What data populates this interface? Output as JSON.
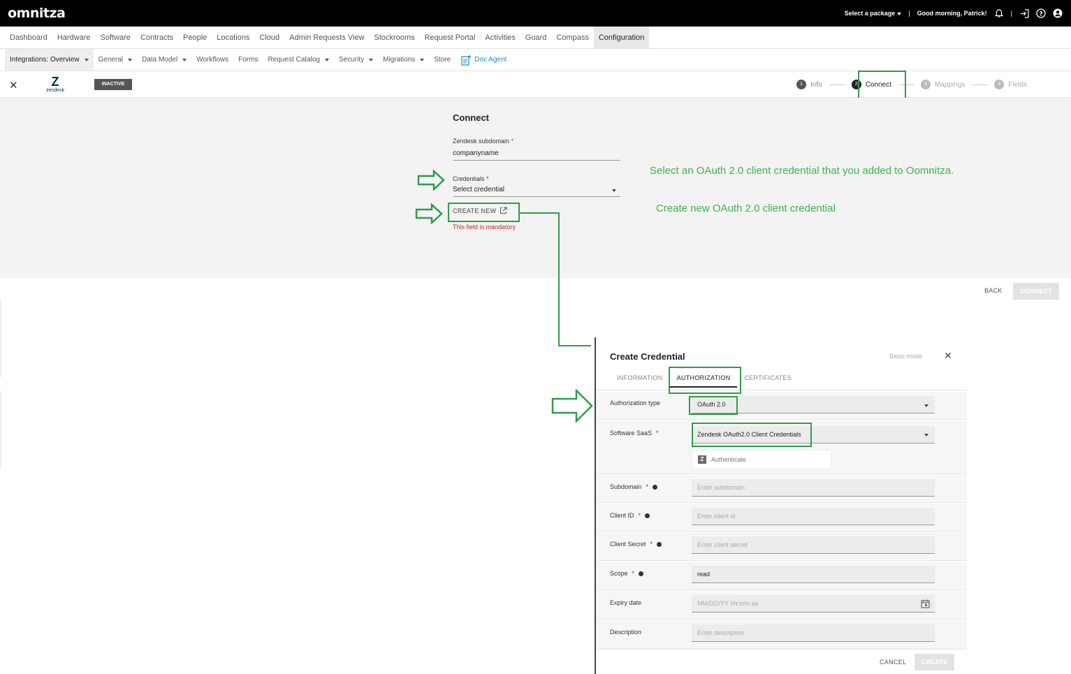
{
  "topbar": {
    "logo": "omnitza",
    "package_label": "Select a package",
    "separator": "|",
    "greeting": "Good morning, Patrick!"
  },
  "main_nav": [
    {
      "label": "Dashboard"
    },
    {
      "label": "Hardware"
    },
    {
      "label": "Software"
    },
    {
      "label": "Contracts"
    },
    {
      "label": "People"
    },
    {
      "label": "Locations"
    },
    {
      "label": "Cloud"
    },
    {
      "label": "Admin Requests View"
    },
    {
      "label": "Stockrooms"
    },
    {
      "label": "Request Portal"
    },
    {
      "label": "Activities"
    },
    {
      "label": "Guard"
    },
    {
      "label": "Compass"
    },
    {
      "label": "Configuration"
    }
  ],
  "sub_nav": [
    {
      "label": "Integrations: Overview"
    },
    {
      "label": "General"
    },
    {
      "label": "Data Model"
    },
    {
      "label": "Workflows"
    },
    {
      "label": "Forms"
    },
    {
      "label": "Request Catalog"
    },
    {
      "label": "Security"
    },
    {
      "label": "Migrations"
    },
    {
      "label": "Store"
    },
    {
      "label": "Doc Agent"
    }
  ],
  "integration": {
    "logo_text": "zendesk",
    "status_badge": "INACTIVE"
  },
  "stepper": [
    {
      "num": "1",
      "label": "Info"
    },
    {
      "num": "2",
      "label": "Connect"
    },
    {
      "num": "3",
      "label": "Mappings"
    },
    {
      "num": "4",
      "label": "Fields"
    }
  ],
  "connect": {
    "title": "Connect",
    "subdomain_label": "Zendesk subdomain",
    "subdomain_value": "companyname",
    "credentials_label": "Credentials",
    "credentials_value": "Select credential",
    "required_mark": "*",
    "create_new": "CREATE NEW",
    "mandatory_msg": "This field is mandatory",
    "back": "BACK",
    "connect_btn": "CONNECT"
  },
  "annotations": {
    "select_cred": "Select an OAuth 2.0 client credential that you added to Oomnitza.",
    "create_cred": "Create new OAuth 2.0 client credential"
  },
  "dialog": {
    "title": "Create Credential",
    "basic_mode": "Basic mode",
    "tabs": [
      {
        "label": "INFORMATION"
      },
      {
        "label": "AUTHORIZATION"
      },
      {
        "label": "CERTIFICATES"
      }
    ],
    "auth_type_label": "Authorization type",
    "auth_type_value": "OAuth 2.0",
    "saas_label": "Software SaaS",
    "saas_value": "Zendesk OAuth2.0 Client Credentials",
    "authenticate": "Authenticate",
    "subdomain_label": "Subdomain",
    "subdomain_placeholder": "Enter subdomain",
    "client_id_label": "Client ID",
    "client_id_placeholder": "Enter client id",
    "client_secret_label": "Client Secret",
    "client_secret_placeholder": "Enter client secret",
    "scope_label": "Scope",
    "scope_value": "read",
    "expiry_label": "Expiry date",
    "expiry_placeholder": "MM/DD/YY hh:mm aa",
    "description_label": "Description",
    "description_placeholder": "Enter description",
    "cancel": "CANCEL",
    "create": "CREATE"
  },
  "colors": {
    "highlight": "#2e9d47",
    "annotation": "#3cb34f",
    "error": "#cc2233",
    "link": "#1b8ad3"
  }
}
